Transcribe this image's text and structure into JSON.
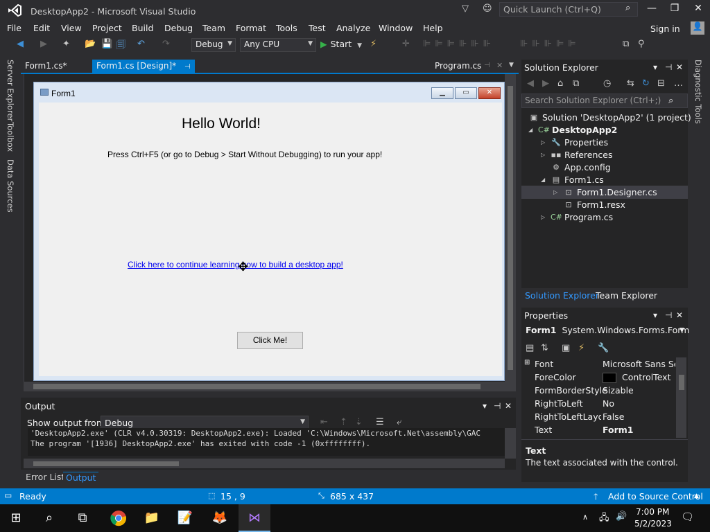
{
  "window": {
    "title": "DesktopApp2 - Microsoft Visual Studio",
    "quick_launch_placeholder": "Quick Launch (Ctrl+Q)",
    "minimize": "—",
    "maximize": "❐",
    "close": "✕"
  },
  "menubar": {
    "items": [
      "File",
      "Edit",
      "View",
      "Project",
      "Build",
      "Debug",
      "Team",
      "Format",
      "Tools",
      "Test",
      "Analyze",
      "Window",
      "Help"
    ],
    "sign_in": "Sign in"
  },
  "toolbar": {
    "configuration": "Debug",
    "platform": "Any CPU",
    "start_label": "Start"
  },
  "left_tabs": [
    "Server Explorer",
    "Toolbox",
    "Data Sources"
  ],
  "right_tabs": [
    "Diagnostic Tools"
  ],
  "doc_tabs": [
    {
      "label": "Form1.cs*",
      "active": false
    },
    {
      "label": "Form1.cs [Design]*",
      "active": true
    },
    {
      "label": "Program.cs",
      "active": false
    }
  ],
  "designer": {
    "form_title": "Form1",
    "hello_label": "Hello World!",
    "instruction_label": "Press Ctrl+F5 (or go to Debug > Start Without Debugging) to run your app!",
    "link_label": "Click here to continue learning how to build a desktop app!",
    "button_label": "Click Me!"
  },
  "output": {
    "title": "Output",
    "show_from_label": "Show output from:",
    "show_from_value": "Debug",
    "lines": [
      "'DesktopApp2.exe' (CLR v4.0.30319: DesktopApp2.exe): Loaded 'C:\\Windows\\Microsoft.Net\\assembly\\GAC",
      "The program '[1936] DesktopApp2.exe' has exited with code -1 (0xffffffff)."
    ]
  },
  "bottom_tabs": [
    {
      "label": "Error List",
      "active": false
    },
    {
      "label": "Output",
      "active": true
    }
  ],
  "solution_explorer": {
    "title": "Solution Explorer",
    "search_placeholder": "Search Solution Explorer (Ctrl+;)",
    "tree": [
      {
        "label": "Solution 'DesktopApp2' (1 project)",
        "icon": "solution-icon"
      },
      {
        "label": "DesktopApp2",
        "icon": "csharp-project-icon"
      },
      {
        "label": "Properties",
        "icon": "wrench-icon"
      },
      {
        "label": "References",
        "icon": "references-icon"
      },
      {
        "label": "App.config",
        "icon": "config-file-icon"
      },
      {
        "label": "Form1.cs",
        "icon": "form-icon"
      },
      {
        "label": "Form1.Designer.cs",
        "icon": "designer-file-icon"
      },
      {
        "label": "Form1.resx",
        "icon": "resx-file-icon"
      },
      {
        "label": "Program.cs",
        "icon": "csharp-file-icon"
      }
    ],
    "tabs": [
      "Solution Explorer",
      "Team Explorer"
    ]
  },
  "properties": {
    "title": "Properties",
    "object_name": "Form1",
    "object_type": "System.Windows.Forms.Form",
    "rows": [
      {
        "name": "Font",
        "value": "Microsoft Sans Serif"
      },
      {
        "name": "ForeColor",
        "value": "ControlText"
      },
      {
        "name": "FormBorderStyle",
        "value": "Sizable"
      },
      {
        "name": "RightToLeft",
        "value": "No"
      },
      {
        "name": "RightToLeftLayout",
        "value": "False"
      },
      {
        "name": "Text",
        "value": "Form1"
      }
    ],
    "desc_title": "Text",
    "desc_text": "The text associated with the control."
  },
  "status": {
    "ready": "Ready",
    "position": "15 , 9",
    "size": "685 x 437",
    "source_control": "Add to Source Control"
  },
  "taskbar": {
    "time": "7:00 PM",
    "date": "5/2/2023"
  },
  "colors": {
    "accent": "#007acc",
    "background": "#2d2d30",
    "panel": "#252526"
  }
}
